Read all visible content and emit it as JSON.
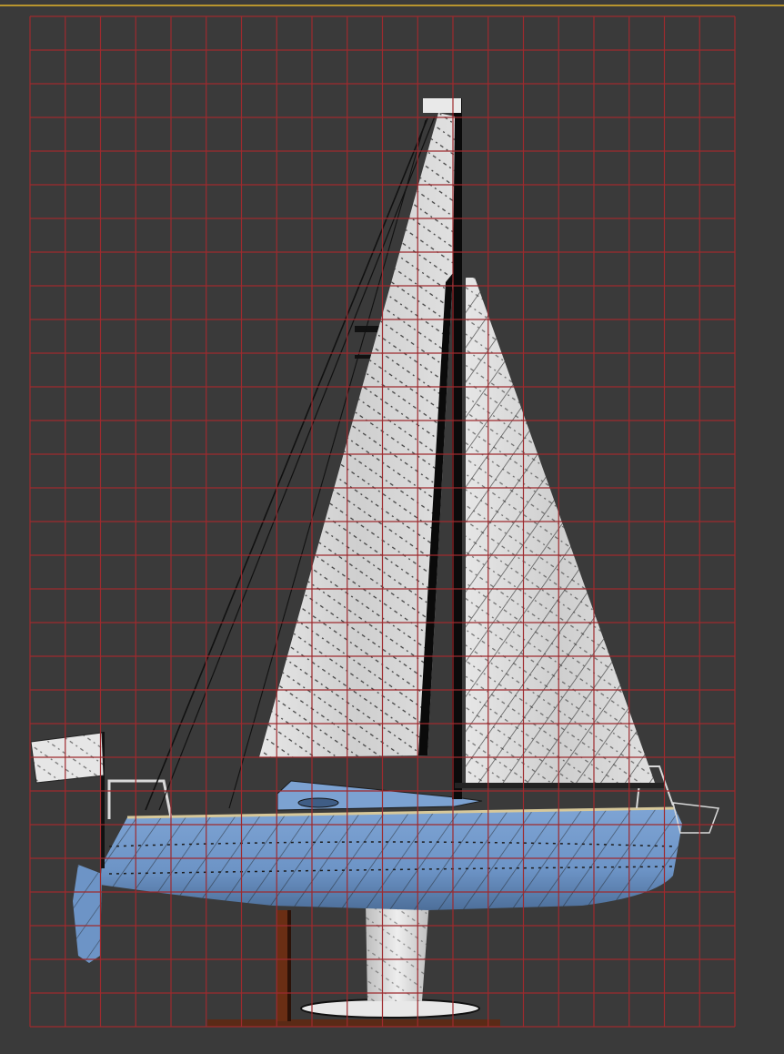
{
  "viewport": {
    "background": "#3a3a3a",
    "active_border_color": "#b8952e"
  },
  "grid": {
    "line_color": "#9e2a2e",
    "columns": 20,
    "rows": 30
  },
  "model": {
    "hull_color": "#6d94c6",
    "sail_color": "#d9d9d9",
    "mast_color": "#0a0a0a"
  },
  "icons": {
    "boat": "sailboat-model"
  }
}
